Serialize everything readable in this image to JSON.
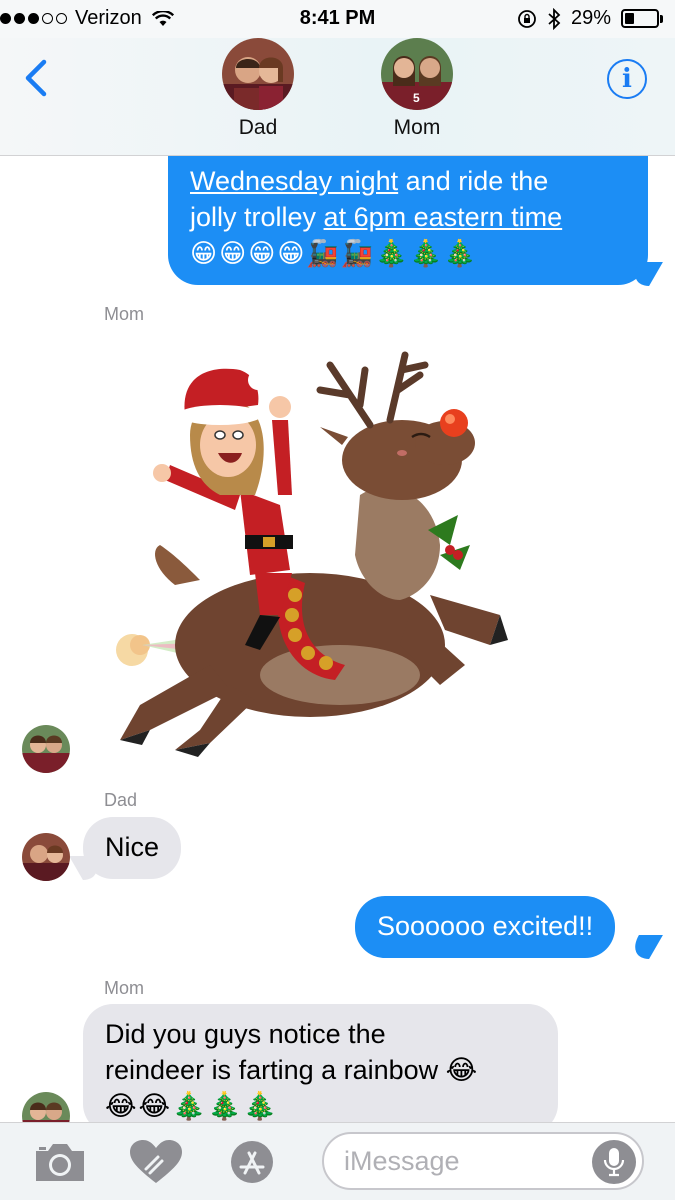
{
  "status_bar": {
    "carrier": "Verizon",
    "time": "8:41 PM",
    "battery_percent": "29%",
    "battery_level": 0.29,
    "signal_bars_filled": 3,
    "signal_bars_total": 5
  },
  "header": {
    "back_icon": "chevron-left-icon",
    "contacts": [
      {
        "name": "Dad"
      },
      {
        "name": "Mom"
      }
    ],
    "info_label": "i"
  },
  "messages": {
    "msg1": {
      "partial_line": "",
      "line2_link": "Wednesday night",
      "line2_rest": " and ride the",
      "line3_plain": "jolly trolley ",
      "line3_link": "at 6pm eastern time",
      "emoji": "😁😁😁😁🚂🚂🎄🎄🎄"
    },
    "sender_mom_1": "Mom",
    "sender_dad": "Dad",
    "nice": "Nice",
    "excited": "Soooooo excited!!",
    "sender_mom_2": "Mom",
    "reindeer_line1": "Did you guys notice the",
    "reindeer_line2": "reindeer is farting a rainbow 😂",
    "reindeer_line3": "😂😂🎄🎄🎄"
  },
  "input_bar": {
    "placeholder": "iMessage"
  },
  "colors": {
    "outgoing_bubble": "#1c8ef5",
    "incoming_bubble": "#e6e6eb",
    "accent": "#1a7cf3"
  }
}
